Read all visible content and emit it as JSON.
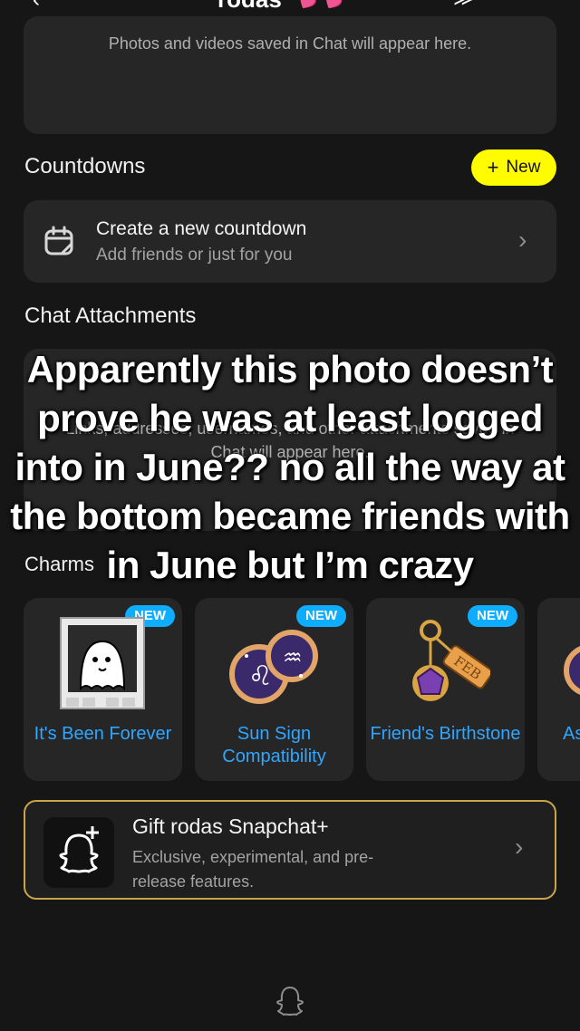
{
  "header": {
    "title": "rodas",
    "hearts": "💕💕"
  },
  "media": {
    "empty_message": "Photos and videos saved in Chat will appear here."
  },
  "countdowns": {
    "title": "Countdowns",
    "new_label": "New",
    "create_title": "Create a new countdown",
    "create_subtitle": "Add friends or just for you"
  },
  "attachments": {
    "title": "Chat Attachments",
    "empty_message": "Links, addresses, usernames, and other attachments saved in Chat will appear here."
  },
  "charms": {
    "title": "Charms",
    "items": [
      {
        "label": "It's Been Forever",
        "badge": "NEW",
        "icon": "ghost-polaroid-icon"
      },
      {
        "label": "Sun Sign Compatibility",
        "badge": "NEW",
        "icon": "zodiac-icon"
      },
      {
        "label": "Friend's Birthstone",
        "badge": "NEW",
        "icon": "birthstone-keychain-icon"
      },
      {
        "label": "As",
        "icon": "charm-icon"
      }
    ]
  },
  "snapchat_plus": {
    "title": "Gift rodas Snapchat+",
    "subtitle": "Exclusive, experimental, and pre-release features."
  },
  "overlay_caption": "Apparently this photo doesn’t prove he was at least logged into in June?? no all the way at the bottom became friends with in June but I’m crazy",
  "colors": {
    "accent_yellow": "#fffc00",
    "charm_blue": "#2fa6ff",
    "badge_blue": "#0fadff",
    "gold_border": "#c9a54a",
    "background": "#161616",
    "card": "#262626"
  }
}
